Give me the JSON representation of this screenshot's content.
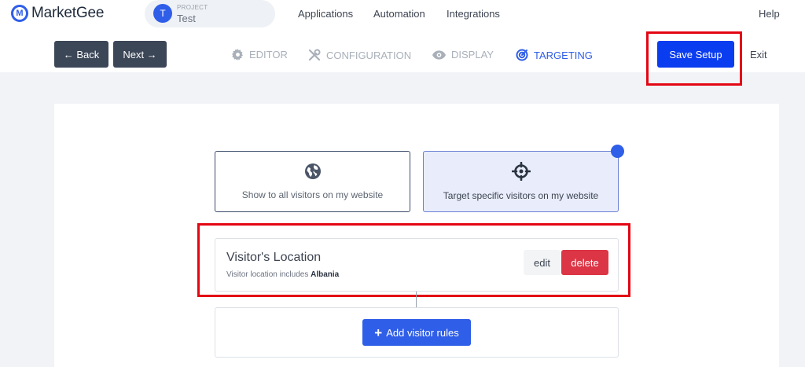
{
  "header": {
    "logo_letter": "M",
    "app_name": "MarketGee",
    "project": {
      "avatar_letter": "T",
      "label": "PROJECT",
      "name": "Test"
    },
    "nav": [
      "Applications",
      "Automation",
      "Integrations"
    ],
    "help_label": "Help"
  },
  "toolbar": {
    "back_label": "← Back",
    "next_label": "Next →",
    "steps": [
      {
        "label": "EDITOR",
        "icon": "gear-icon",
        "active": false
      },
      {
        "label": "CONFIGURATION",
        "icon": "tools-icon",
        "active": false
      },
      {
        "label": "DISPLAY",
        "icon": "eye-icon",
        "active": false
      },
      {
        "label": "TARGETING",
        "icon": "target-icon",
        "active": true
      }
    ],
    "save_label": "Save Setup",
    "exit_label": "Exit"
  },
  "targeting": {
    "options": [
      {
        "label": "Show to all visitors on my website",
        "icon": "globe-icon",
        "selected": false
      },
      {
        "label": "Target specific visitors on my website",
        "icon": "crosshair-icon",
        "selected": true
      }
    ],
    "rule": {
      "title": "Visitor's Location",
      "description_prefix": "Visitor location includes",
      "description_value": "Albania",
      "edit_label": "edit",
      "delete_label": "delete"
    },
    "add_rule_label": "Add visitor rules"
  },
  "colors": {
    "accent": "#2f5ee8",
    "save_button": "#0a3cf0",
    "danger": "#dc3545",
    "highlight_frame": "#e30613",
    "dark_button": "#3b4657"
  }
}
